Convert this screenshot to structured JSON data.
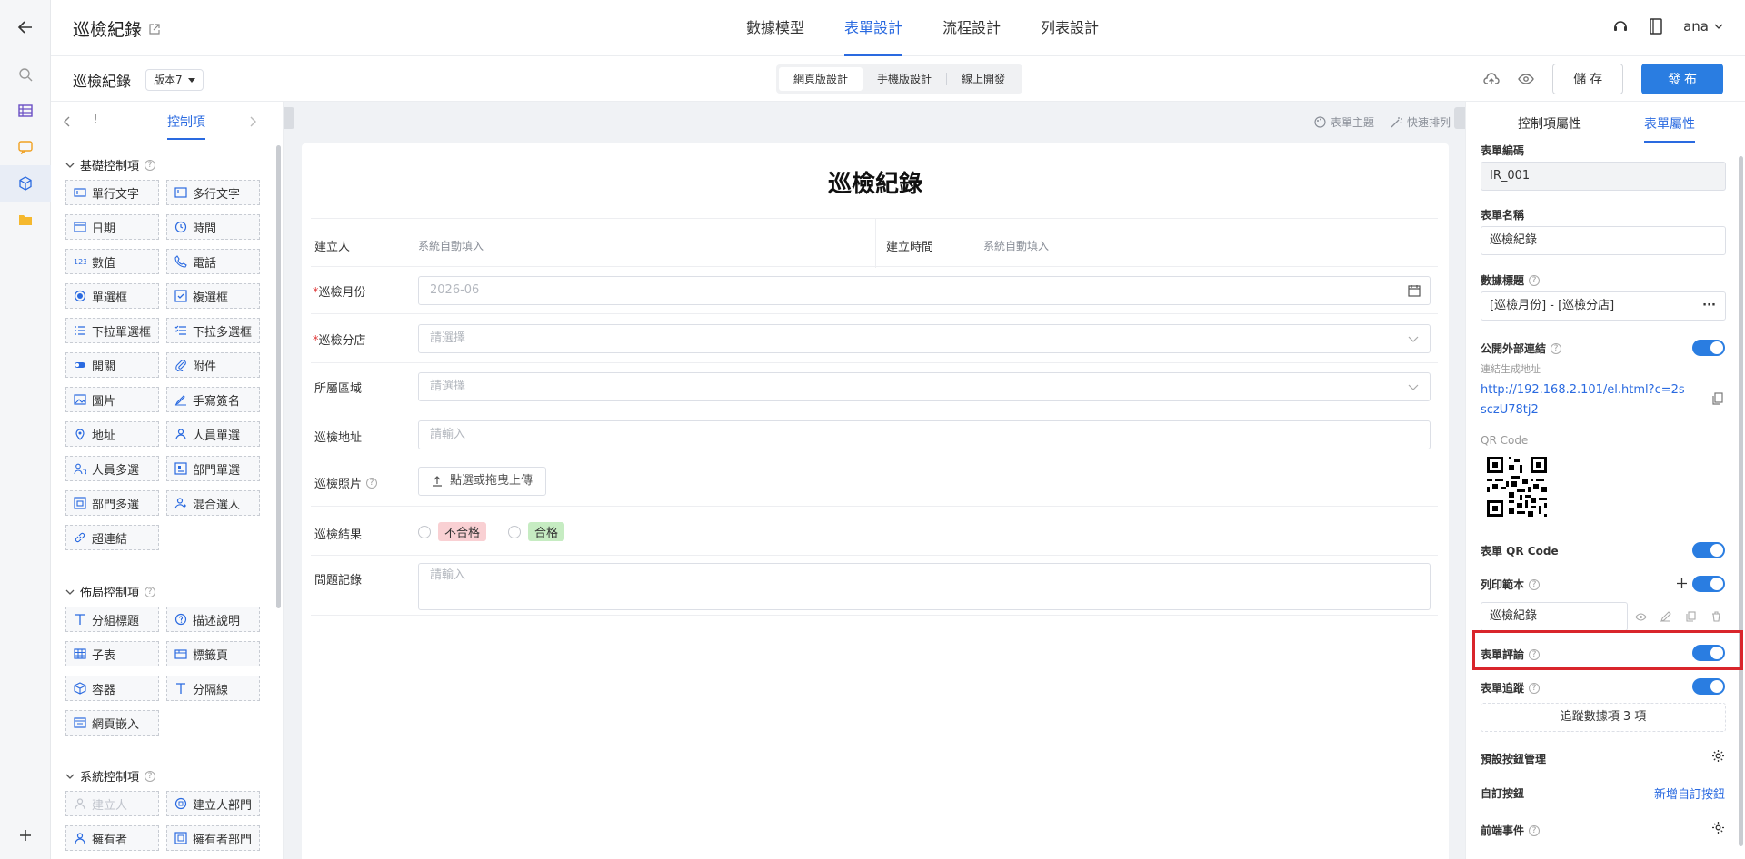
{
  "app": {
    "title": "巡檢紀錄",
    "user": "ana"
  },
  "top_tabs": [
    {
      "label": "數據模型"
    },
    {
      "label": "表單設計"
    },
    {
      "label": "流程設計"
    },
    {
      "label": "列表設計"
    }
  ],
  "subbar": {
    "form_name": "巡檢紀錄",
    "version": "版本7",
    "modes": [
      {
        "label": "網頁版設計"
      },
      {
        "label": "手機版設計"
      },
      {
        "label": "線上開發"
      }
    ],
    "save": "儲 存",
    "publish": "發 布"
  },
  "left": {
    "tab_label": "控制項",
    "tab_icon_label": "!",
    "sections": [
      {
        "title": "基礎控制項",
        "items": [
          {
            "label": "單行文字",
            "icon": "single-line-icon"
          },
          {
            "label": "多行文字",
            "icon": "multi-line-icon"
          },
          {
            "label": "日期",
            "icon": "calendar-icon"
          },
          {
            "label": "時間",
            "icon": "clock-icon"
          },
          {
            "label": "數值",
            "icon": "number-icon"
          },
          {
            "label": "電話",
            "icon": "phone-icon"
          },
          {
            "label": "單選框",
            "icon": "radio-icon"
          },
          {
            "label": "複選框",
            "icon": "checkbox-icon"
          },
          {
            "label": "下拉單選框",
            "icon": "dropdown-single-icon"
          },
          {
            "label": "下拉多選框",
            "icon": "dropdown-multi-icon"
          },
          {
            "label": "開關",
            "icon": "switch-icon"
          },
          {
            "label": "附件",
            "icon": "attachment-icon"
          },
          {
            "label": "圖片",
            "icon": "image-icon"
          },
          {
            "label": "手寫簽名",
            "icon": "signature-icon"
          },
          {
            "label": "地址",
            "icon": "location-icon"
          },
          {
            "label": "人員單選",
            "icon": "user-icon"
          },
          {
            "label": "人員多選",
            "icon": "users-icon"
          },
          {
            "label": "部門單選",
            "icon": "department-icon"
          },
          {
            "label": "部門多選",
            "icon": "departments-icon"
          },
          {
            "label": "混合選人",
            "icon": "mixed-user-icon"
          },
          {
            "label": "超連結",
            "icon": "link-icon"
          }
        ]
      },
      {
        "title": "佈局控制項",
        "items": [
          {
            "label": "分組標題",
            "icon": "group-title-icon"
          },
          {
            "label": "描述說明",
            "icon": "help-icon"
          },
          {
            "label": "子表",
            "icon": "table-icon"
          },
          {
            "label": "標籤頁",
            "icon": "tabs-icon"
          },
          {
            "label": "容器",
            "icon": "container-icon"
          },
          {
            "label": "分隔線",
            "icon": "divider-icon"
          },
          {
            "label": "網頁嵌入",
            "icon": "embed-icon"
          }
        ]
      },
      {
        "title": "系統控制項",
        "items": [
          {
            "label": "建立人",
            "icon": "creator-icon",
            "disabled": true
          },
          {
            "label": "建立人部門",
            "icon": "creator-dept-icon"
          },
          {
            "label": "擁有者",
            "icon": "owner-icon"
          },
          {
            "label": "擁有者部門",
            "icon": "owner-dept-icon"
          }
        ]
      }
    ]
  },
  "canvas": {
    "tools": [
      "表單主題",
      "快速排列"
    ],
    "title": "巡檢紀錄",
    "fields": {
      "creator_label": "建立人",
      "creator_value": "系統自動填入",
      "created_time_label": "建立時間",
      "created_time_value": "系統自動填入",
      "month_label": "巡檢月份",
      "month_value": "2026-06",
      "branch_label": "巡檢分店",
      "branch_placeholder": "請選擇",
      "region_label": "所屬區域",
      "region_placeholder": "請選擇",
      "address_label": "巡檢地址",
      "address_placeholder": "請輸入",
      "photo_label": "巡檢照片",
      "photo_button": "點選或拖曳上傳",
      "result_label": "巡檢結果",
      "result_fail": "不合格",
      "result_pass": "合格",
      "issue_label": "問題記錄",
      "issue_placeholder": "請輸入"
    }
  },
  "right": {
    "tabs": [
      "控制項屬性",
      "表單屬性"
    ],
    "form_code_label": "表單編碼",
    "form_code": "IR_001",
    "form_name_label": "表單名稱",
    "form_name": "巡檢紀錄",
    "data_title_label": "數據標題",
    "data_title": "[巡檢月份] - [巡檢分店]",
    "public_link_label": "公開外部連結",
    "public_link_sub": "連結生成地址",
    "public_link_url": "http://192.168.2.101/el.html?c=2ssczU78tj2",
    "qr_label": "QR Code",
    "form_qr_label": "表單 QR Code",
    "print_label": "列印範本",
    "print_value": "巡檢紀錄",
    "comment_label": "表單評論",
    "track_label": "表單追蹤",
    "track_button": "追蹤數據項 3 項",
    "preset_buttons_label": "預設按鈕管理",
    "custom_button_label": "自訂按鈕",
    "custom_button_link": "新增自訂按鈕",
    "frontend_event_label": "前端事件"
  },
  "colors": {
    "accent": "#2a7de1",
    "highlight": "#d9252b",
    "fail_tag": "#f9d0d3",
    "pass_tag": "#c6ecc2"
  }
}
